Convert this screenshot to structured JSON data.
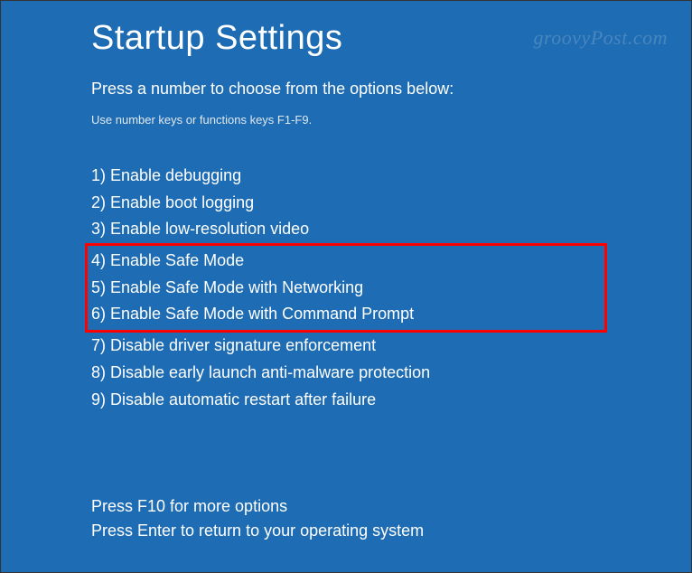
{
  "title": "Startup Settings",
  "subtitle": "Press a number to choose from the options below:",
  "hint": "Use number keys or functions keys F1-F9.",
  "options": [
    {
      "label": "1) Enable debugging",
      "highlighted": false
    },
    {
      "label": "2) Enable boot logging",
      "highlighted": false
    },
    {
      "label": "3) Enable low-resolution video",
      "highlighted": false
    },
    {
      "label": "4) Enable Safe Mode",
      "highlighted": true
    },
    {
      "label": "5) Enable Safe Mode with Networking",
      "highlighted": true
    },
    {
      "label": "6) Enable Safe Mode with Command Prompt",
      "highlighted": true
    },
    {
      "label": "7) Disable driver signature enforcement",
      "highlighted": false
    },
    {
      "label": "8) Disable early launch anti-malware protection",
      "highlighted": false
    },
    {
      "label": "9) Disable automatic restart after failure",
      "highlighted": false
    }
  ],
  "footer": {
    "line1": "Press F10 for more options",
    "line2": "Press Enter to return to your operating system"
  },
  "watermark": "groovyPost.com"
}
